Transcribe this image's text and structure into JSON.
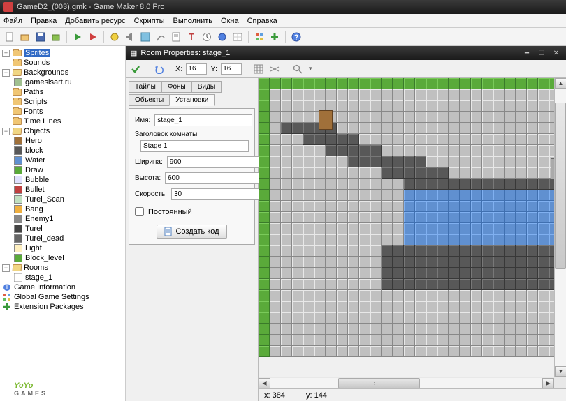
{
  "title": "GameD2_(003).gmk - Game Maker 8.0 Pro",
  "menu": [
    "Файл",
    "Правка",
    "Добавить ресурс",
    "Скрипты",
    "Выполнить",
    "Окна",
    "Справка"
  ],
  "tree": {
    "sprites": "Sprites",
    "sounds": "Sounds",
    "backgrounds": "Backgrounds",
    "bg_item": "gamesisart.ru",
    "paths": "Paths",
    "scripts": "Scripts",
    "fonts": "Fonts",
    "timelines": "Time Lines",
    "objects": "Objects",
    "obj": [
      "Hero",
      "block",
      "Water",
      "Draw",
      "Bubble",
      "Bullet",
      "Turel_Scan",
      "Bang",
      "Enemy1",
      "Turel",
      "Turel_dead",
      "Light",
      "Block_level"
    ],
    "rooms": "Rooms",
    "room_item": "stage_1",
    "game_info": "Game Information",
    "global_settings": "Global Game Settings",
    "ext_packages": "Extension Packages"
  },
  "room_window": {
    "title": "Room Properties: stage_1",
    "snap_x_label": "X:",
    "snap_x": "16",
    "snap_y_label": "Y:",
    "snap_y": "16",
    "tabs": [
      "Тайлы",
      "Фоны",
      "Виды",
      "Объекты",
      "Установки"
    ],
    "name_label": "Имя:",
    "name": "stage_1",
    "caption_label": "Заголовок комнаты",
    "caption": "Stage 1",
    "width_label": "Ширина:",
    "width": "900",
    "height_label": "Высота:",
    "height": "600",
    "speed_label": "Скорость:",
    "speed": "30",
    "persistent": "Постоянный",
    "create_code": "Создать код",
    "status_x_label": "x:",
    "status_x": "384",
    "status_y_label": "y:",
    "status_y": "144"
  },
  "logo": {
    "part1": "YoYo",
    "sub": "GAMES"
  },
  "colors": {
    "green": "#5aaa3a",
    "dark": "#585858",
    "water": "#6090d0",
    "grey": "#c0c0c0"
  }
}
